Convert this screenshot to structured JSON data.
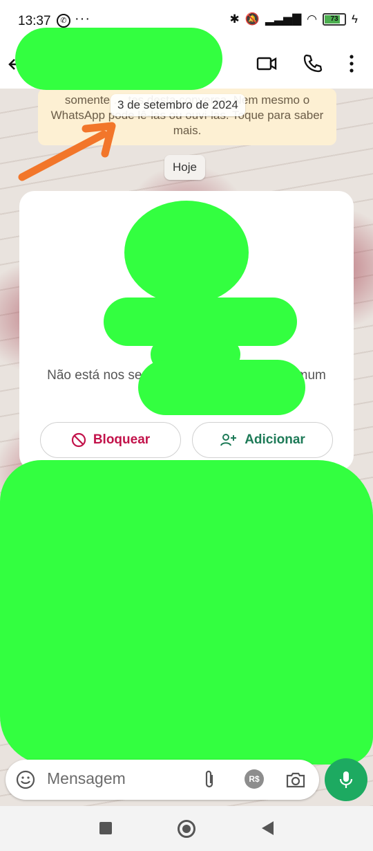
{
  "status_bar": {
    "time": "13:37",
    "more": "···",
    "battery": "73"
  },
  "app_bar": {
    "back_icon": "arrow-left-icon",
    "video_icon": "video-camera-icon",
    "call_icon": "phone-icon",
    "menu_icon": "more-vertical-icon"
  },
  "chat": {
    "encryption_text": "somente … tes desta conversa. Nem mesmo o WhatsApp pode lê-las ou ouvi-las. Toque para saber mais.",
    "date_chip": "3 de setembro de 2024",
    "today_chip": "Hoje",
    "contact_info": "Não está nos seus contatos • Grupo em comum",
    "block_label": "Bloquear",
    "add_label": "Adicionar"
  },
  "composer": {
    "placeholder": "Mensagem"
  },
  "colors": {
    "accent": "#1daa61",
    "block": "#c2124a",
    "add": "#1d7a57",
    "redaction": "#33ff40",
    "annotation": "#f2762a"
  }
}
